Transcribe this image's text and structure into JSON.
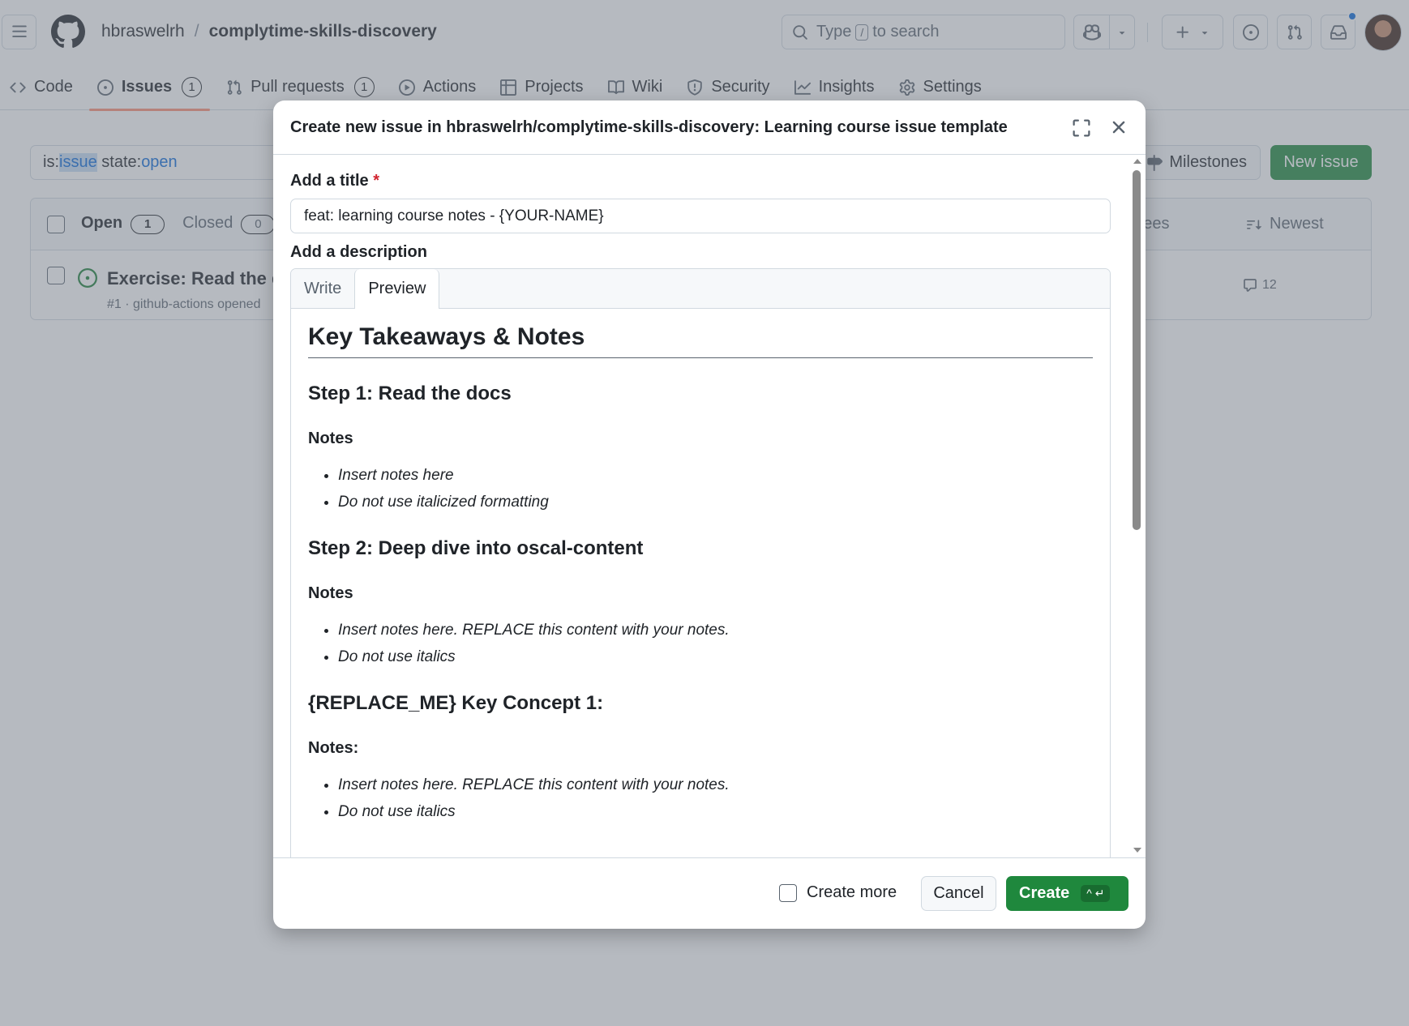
{
  "header": {
    "owner": "hbraswelrh",
    "separator": "/",
    "repo": "complytime-skills-discovery",
    "search_prefix": "Type",
    "search_key": "/",
    "search_suffix": "to search"
  },
  "nav": {
    "tabs": [
      {
        "label": "Code",
        "icon": "code-icon"
      },
      {
        "label": "Issues",
        "icon": "issue-opened-icon",
        "count": "1",
        "selected": true
      },
      {
        "label": "Pull requests",
        "icon": "git-pull-request-icon",
        "count": "1"
      },
      {
        "label": "Actions",
        "icon": "play-icon"
      },
      {
        "label": "Projects",
        "icon": "table-icon"
      },
      {
        "label": "Wiki",
        "icon": "book-icon"
      },
      {
        "label": "Security",
        "icon": "shield-icon"
      },
      {
        "label": "Insights",
        "icon": "graph-icon"
      },
      {
        "label": "Settings",
        "icon": "gear-icon"
      }
    ]
  },
  "issues_page": {
    "filter": {
      "p1": "is:",
      "k1": "issue",
      "p2": " state:",
      "k2": "open"
    },
    "milestones_label": "Milestones",
    "new_issue_label": "New issue",
    "open_label": "Open",
    "open_count": "1",
    "closed_label": "Closed",
    "closed_count": "0",
    "assignees_label": "gnees",
    "sort_label": "Newest",
    "issue": {
      "title": "Exercise: Read the d",
      "meta": "#1 · github-actions opened",
      "comments": "12"
    }
  },
  "modal": {
    "title": "Create new issue in hbraswelrh/complytime-skills-discovery: Learning course issue template",
    "title_label": "Add a title",
    "required_mark": "*",
    "title_value": "feat: learning course notes - {YOUR-NAME}",
    "description_label": "Add a description",
    "tab_write": "Write",
    "tab_preview": "Preview",
    "preview": {
      "h1": "Key Takeaways & Notes",
      "step1": "Step 1: Read the docs",
      "notes1": "Notes",
      "step1_items": [
        "Insert notes here",
        "Do not use italicized formatting"
      ],
      "step2": "Step 2: Deep dive into oscal-content",
      "notes2": "Notes",
      "step2_items": [
        "Insert notes here. REPLACE this content with your notes.",
        "Do not use italics"
      ],
      "concept1": "{REPLACE_ME} Key Concept 1:",
      "notes3": "Notes:",
      "concept1_items": [
        "Insert notes here. REPLACE this content with your notes.",
        "Do not use italics"
      ]
    },
    "create_more_label": "Create more",
    "cancel_label": "Cancel",
    "create_label": "Create",
    "create_shortcut": "^ ↵"
  },
  "colors": {
    "primary_green": "#1f883d",
    "tab_underline": "#fd8c73",
    "link_blue": "#0969da",
    "required_red": "#d1242f"
  }
}
